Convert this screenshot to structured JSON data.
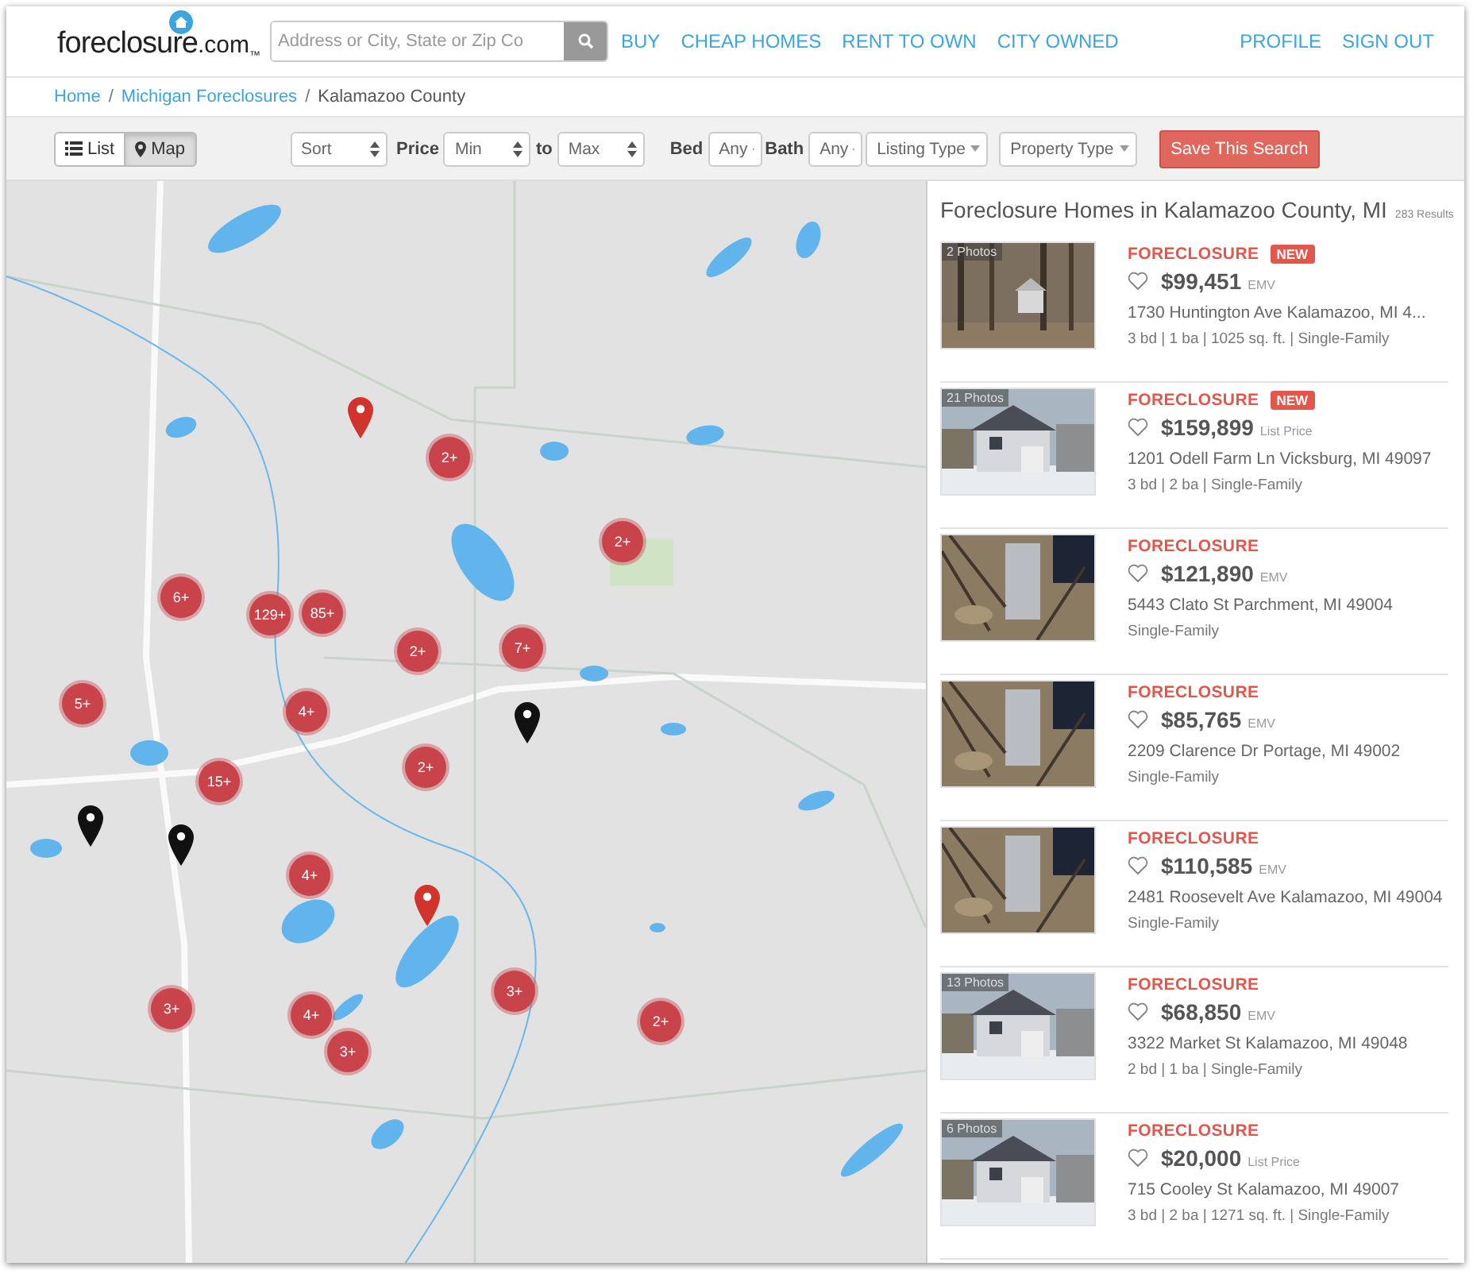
{
  "header": {
    "logo": {
      "name": "foreclosure",
      "suffix": ".com",
      "mark": "™"
    },
    "search": {
      "placeholder": "Address or City, State or Zip Co"
    },
    "nav": [
      "BUY",
      "CHEAP HOMES",
      "RENT TO OWN",
      "CITY OWNED"
    ],
    "account": [
      "PROFILE",
      "SIGN OUT"
    ]
  },
  "breadcrumb": [
    {
      "label": "Home",
      "link": true,
      "separator": "/"
    },
    {
      "label": "Michigan Foreclosures",
      "link": true,
      "separator": "/"
    },
    {
      "label": "Kalamazoo County",
      "link": false
    }
  ],
  "toolbar": {
    "views": [
      {
        "label": "List",
        "selected": false
      },
      {
        "label": "Map",
        "selected": true
      }
    ],
    "sort": "Sort",
    "price_label": "Price",
    "price_min": "Min",
    "to": "to",
    "price_max": "Max",
    "bed_label": "Bed",
    "bed": "Any",
    "bath_label": "Bath",
    "bath": "Any",
    "listing_type": "Listing Type",
    "property_type": "Property Type",
    "save": "Save This Search"
  },
  "map": {
    "clusters": [
      "2+",
      "2+",
      "6+",
      "129+",
      "85+",
      "2+",
      "7+",
      "5+",
      "4+",
      "2+",
      "15+",
      "4+",
      "3+",
      "2+",
      "3+",
      "4+",
      "3+"
    ],
    "pins": [
      {
        "color": "#d0342c"
      },
      {
        "color": "#111111"
      },
      {
        "color": "#111111"
      },
      {
        "color": "#111111"
      },
      {
        "color": "#d0342c"
      }
    ]
  },
  "results": {
    "title": "Foreclosure Homes in Kalamazoo County, MI",
    "count": "283 Results",
    "listings": [
      {
        "photos": "2 Photos",
        "type": "FORECLOSURE",
        "new": true,
        "badge": "NEW",
        "price": "$99,451",
        "price_note": "EMV",
        "address": "1730 Huntington Ave Kalamazoo, MI 4...",
        "details": "3 bd | 1 ba | 1025 sq. ft. | Single-Family"
      },
      {
        "photos": "21 Photos",
        "type": "FORECLOSURE",
        "new": true,
        "badge": "NEW",
        "price": "$159,899",
        "price_note": "List Price",
        "address": "1201 Odell Farm Ln Vicksburg, MI 49097",
        "details": "3 bd | 2 ba | Single-Family"
      },
      {
        "type": "FORECLOSURE",
        "new": false,
        "price": "$121,890",
        "price_note": "EMV",
        "address": "5443 Clato St Parchment, MI 49004",
        "details": "Single-Family"
      },
      {
        "type": "FORECLOSURE",
        "new": false,
        "price": "$85,765",
        "price_note": "EMV",
        "address": "2209 Clarence Dr Portage, MI 49002",
        "details": "Single-Family"
      },
      {
        "type": "FORECLOSURE",
        "new": false,
        "price": "$110,585",
        "price_note": "EMV",
        "address": "2481 Roosevelt Ave Kalamazoo, MI 49004",
        "details": "Single-Family"
      },
      {
        "photos": "13 Photos",
        "type": "FORECLOSURE",
        "new": false,
        "price": "$68,850",
        "price_note": "EMV",
        "address": "3322 Market St Kalamazoo, MI 49048",
        "details": "2 bd | 1 ba | Single-Family"
      },
      {
        "photos": "6 Photos",
        "type": "FORECLOSURE",
        "new": false,
        "price": "$20,000",
        "price_note": "List Price",
        "address": "715 Cooley St Kalamazoo, MI 49007",
        "details": "3 bd | 2 ba | 1271 sq. ft. | Single-Family"
      }
    ]
  }
}
